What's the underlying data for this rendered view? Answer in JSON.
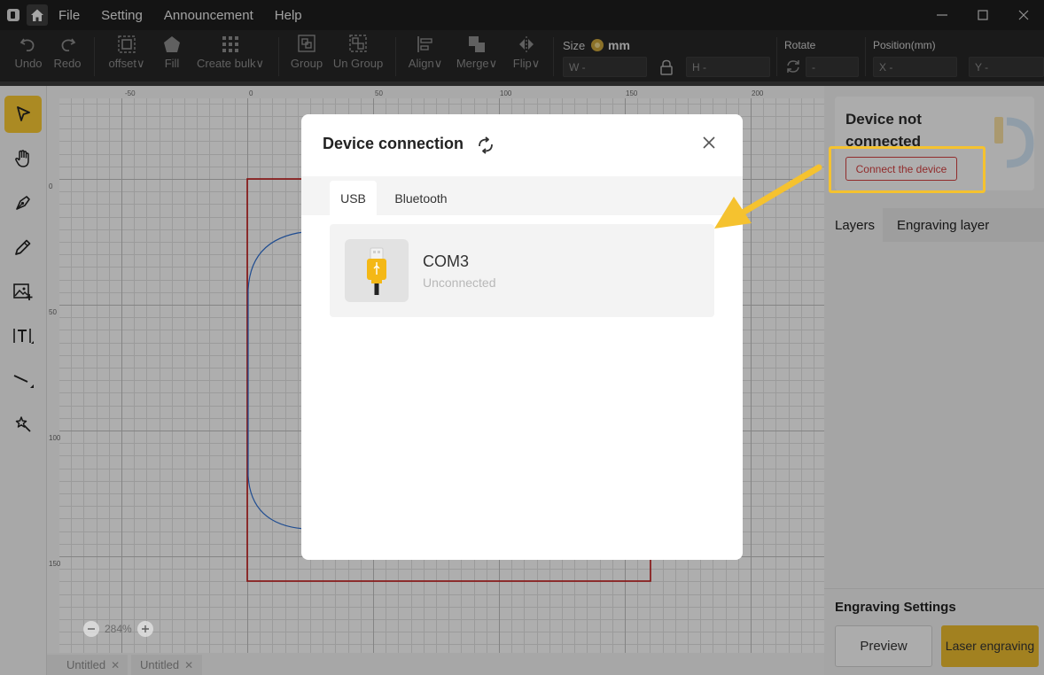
{
  "menubar": {
    "items": [
      "File",
      "Setting",
      "Announcement",
      "Help"
    ],
    "window_controls": [
      "minimize-icon",
      "maximize-icon",
      "close-icon"
    ]
  },
  "toolbar": {
    "tools": [
      {
        "label": "Undo",
        "icon": "undo-icon"
      },
      {
        "label": "Redo",
        "icon": "redo-icon"
      },
      {
        "label": "offset",
        "icon": "offset-icon"
      },
      {
        "label": "Fill",
        "icon": "fill-icon"
      },
      {
        "label": "Create bulk",
        "icon": "grid-icon"
      },
      {
        "label": "Group",
        "icon": "group-icon"
      },
      {
        "label": "Un Group",
        "icon": "ungroup-icon"
      },
      {
        "label": "Align",
        "icon": "align-icon"
      },
      {
        "label": "Merge",
        "icon": "merge-icon"
      },
      {
        "label": "Flip",
        "icon": "flip-icon"
      }
    ],
    "size_label": "Size",
    "size_unit": "mm",
    "width_placeholder": "W -",
    "height_placeholder": "H -",
    "rotate_label": "Rotate",
    "rotate_placeholder": "-",
    "position_label": "Position(mm)",
    "x_placeholder": "X -",
    "y_placeholder": "Y -"
  },
  "left_tools": [
    "select-icon",
    "hand-icon",
    "pen-icon",
    "pencil-icon",
    "image-add-icon",
    "text-icon",
    "line-icon",
    "magic-icon"
  ],
  "canvas": {
    "ruler_top": [
      "-50",
      "0",
      "50",
      "100",
      "150",
      "200"
    ],
    "ruler_left": [
      "0",
      "50",
      "100",
      "150"
    ],
    "zoom_level": "284%"
  },
  "doc_tabs": [
    "Untitled",
    "Untitled"
  ],
  "right_panel": {
    "device_status": "Device not connected",
    "connect_button": "Connect the device",
    "tabs": [
      "Layers",
      "Engraving layer"
    ],
    "engraving_title": "Engraving Settings",
    "preview_button": "Preview",
    "laser_button": "Laser engraving"
  },
  "modal": {
    "title": "Device connection",
    "tabs": [
      "USB",
      "Bluetooth"
    ],
    "device": {
      "name": "COM3",
      "status": "Unconnected"
    }
  },
  "colors": {
    "accent": "#f5c633",
    "highlight": "#f5c22f",
    "danger": "#d04040"
  }
}
